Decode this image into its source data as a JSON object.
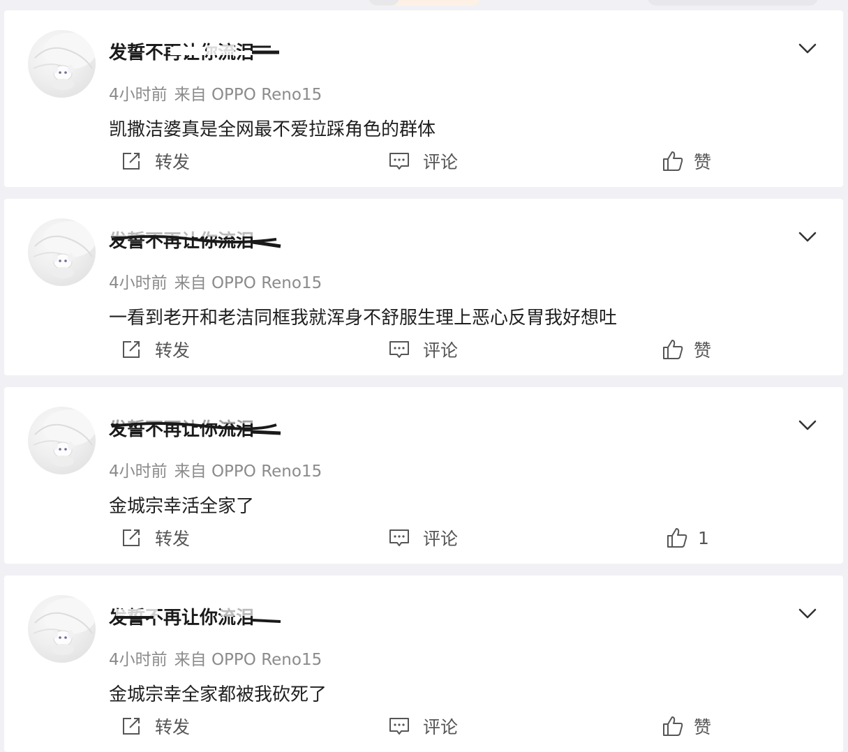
{
  "posts": [
    {
      "username": "发誓不再让你流泪",
      "time": "4小时前",
      "source": "来自 OPPO Reno15",
      "content": "凯撒洁婆真是全网最不爱拉踩角色的群体",
      "repost_label": "转发",
      "comment_label": "评论",
      "like_label": "赞"
    },
    {
      "username": "发誓不再让你流泪",
      "time": "4小时前",
      "source": "来自 OPPO Reno15",
      "content": "一看到老开和老洁同框我就浑身不舒服生理上恶心反胃我好想吐",
      "repost_label": "转发",
      "comment_label": "评论",
      "like_label": "赞"
    },
    {
      "username": "发誓不再让你流泪",
      "time": "4小时前",
      "source": "来自 OPPO Reno15",
      "content": "金城宗幸活全家了",
      "repost_label": "转发",
      "comment_label": "评论",
      "like_label": "1"
    },
    {
      "username": "发誓不再让你流泪",
      "time": "4小时前",
      "source": "来自 OPPO Reno15",
      "content": "金城宗幸全家都被我砍死了",
      "repost_label": "转发",
      "comment_label": "评论",
      "like_label": "赞"
    }
  ],
  "icons": {
    "repost": "repost-icon",
    "comment": "comment-icon",
    "like": "thumbs-up-icon",
    "more": "chevron-down-icon"
  },
  "colors": {
    "background": "#f1f1f5",
    "card": "#ffffff",
    "text": "#1f1f1f",
    "meta": "#8b8b8b",
    "action": "#555555"
  }
}
